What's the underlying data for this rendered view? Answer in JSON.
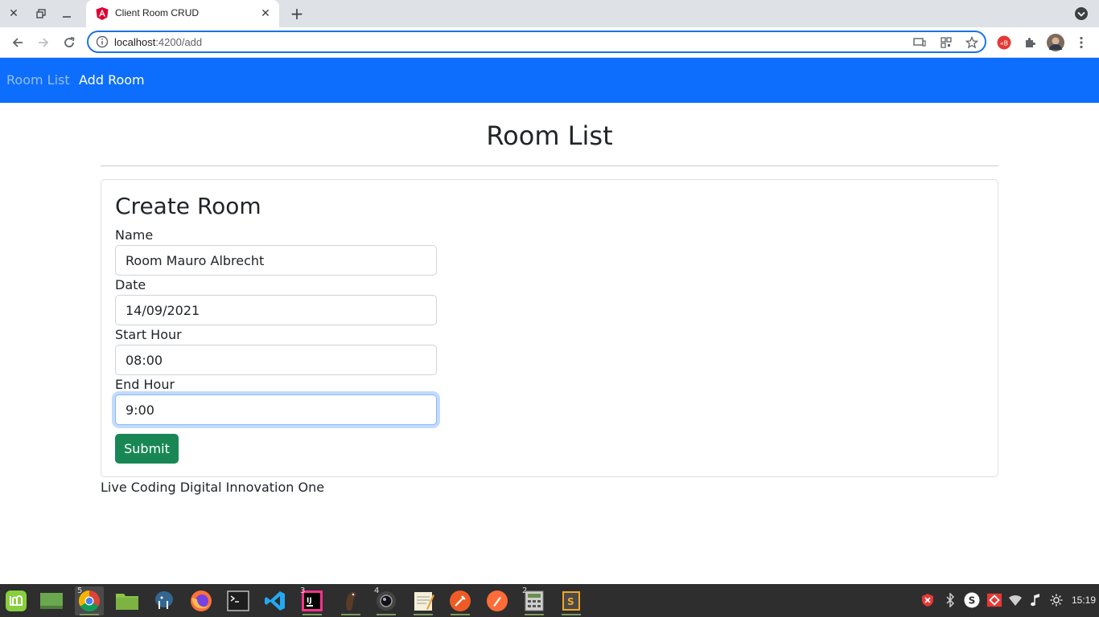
{
  "browser": {
    "tab_title": "Client Room CRUD",
    "url_host": "localhost",
    "url_rest": ":4200/add",
    "icons": [
      "close-icon",
      "restore-icon",
      "minimize-icon",
      "angular-icon",
      "tab-close-icon",
      "new-tab-icon",
      "tab-search-icon",
      "back-icon",
      "forward-icon",
      "reload-icon",
      "info-icon",
      "cast-icon",
      "qr-icon",
      "bookmark-star-icon",
      "extension-badge-icon",
      "puzzle-icon",
      "profile-avatar",
      "menu-kebab-icon"
    ]
  },
  "nav": {
    "room_list": "Room List",
    "add_room": "Add Room"
  },
  "page": {
    "title": "Room List"
  },
  "form": {
    "title": "Create Room",
    "name_label": "Name",
    "name_value": "Room Mauro Albrecht",
    "date_label": "Date",
    "date_value": "14/09/2021",
    "start_label": "Start Hour",
    "start_value": "08:00",
    "end_label": "End Hour",
    "end_value": "9:00",
    "submit_label": "Submit"
  },
  "footer": {
    "text": "Live Coding Digital Innovation One"
  },
  "taskbar": {
    "apps": [
      {
        "name": "mint-menu-icon"
      },
      {
        "name": "show-desktop-icon"
      },
      {
        "name": "chrome-icon",
        "badge": "5"
      },
      {
        "name": "files-icon"
      },
      {
        "name": "postgresql-icon"
      },
      {
        "name": "firefox-icon"
      },
      {
        "name": "terminal-icon"
      },
      {
        "name": "vscode-icon"
      },
      {
        "name": "intellij-icon",
        "badge": "3"
      },
      {
        "name": "dbeaver-icon"
      },
      {
        "name": "camera-icon",
        "badge": "4"
      },
      {
        "name": "text-editor-icon"
      },
      {
        "name": "postman-icon"
      },
      {
        "name": "paw-icon"
      },
      {
        "name": "calculator-icon",
        "badge": "2"
      },
      {
        "name": "sublime-icon"
      }
    ],
    "clock": "15:19",
    "colors": {
      "bar": "#2e2e2e",
      "accent": "#0d6efd",
      "success": "#198754"
    }
  }
}
